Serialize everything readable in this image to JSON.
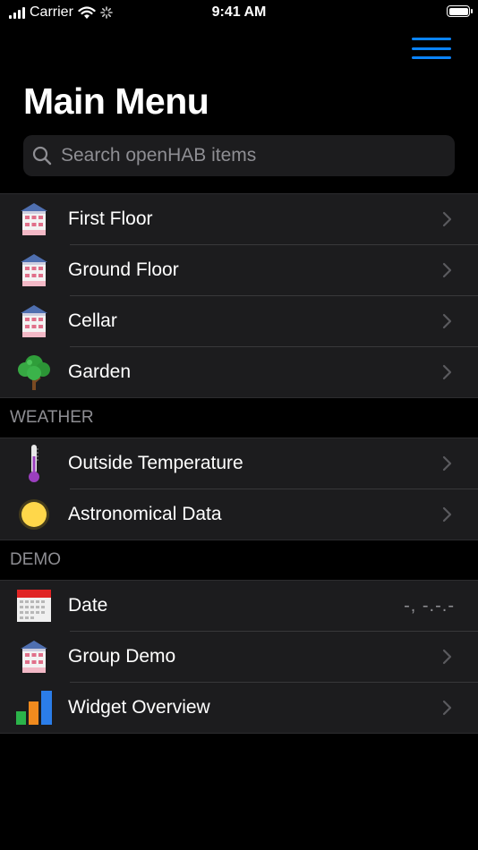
{
  "status_bar": {
    "carrier": "Carrier",
    "time": "9:41 AM"
  },
  "nav": {
    "title": "Main Menu",
    "menu_icon": "hamburger-icon"
  },
  "search": {
    "placeholder": "Search openHAB items",
    "value": ""
  },
  "colors": {
    "accent": "#0a84ff",
    "background": "#000000",
    "cell": "#1c1c1e",
    "secondary_text": "#8e8e93"
  },
  "sections": [
    {
      "header": "",
      "rows": [
        {
          "label": "First Floor",
          "icon": "house-icon",
          "chevron": true
        },
        {
          "label": "Ground Floor",
          "icon": "house-icon",
          "chevron": true
        },
        {
          "label": "Cellar",
          "icon": "house-icon",
          "chevron": true
        },
        {
          "label": "Garden",
          "icon": "tree-icon",
          "chevron": true
        }
      ]
    },
    {
      "header": "Weather",
      "rows": [
        {
          "label": "Outside Temperature",
          "icon": "thermometer-icon",
          "chevron": true
        },
        {
          "label": "Astronomical Data",
          "icon": "sun-icon",
          "chevron": true
        }
      ]
    },
    {
      "header": "Demo",
      "rows": [
        {
          "label": "Date",
          "icon": "calendar-icon",
          "value": "-, -.-.-",
          "chevron": false
        },
        {
          "label": "Group Demo",
          "icon": "house-icon",
          "chevron": true
        },
        {
          "label": "Widget Overview",
          "icon": "bar-chart-icon",
          "chevron": true
        }
      ]
    }
  ]
}
